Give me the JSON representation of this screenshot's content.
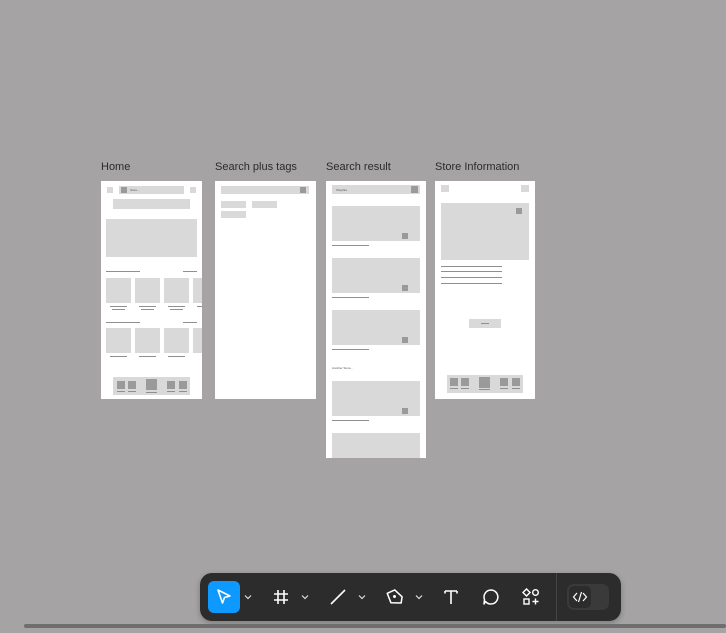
{
  "frames": [
    {
      "label": "Home"
    },
    {
      "label": "Search plus tags"
    },
    {
      "label": "Search result"
    },
    {
      "label": "Store Information"
    }
  ],
  "home": {
    "search_text": "Store..."
  },
  "search_result": {
    "search_text": "Shopfire",
    "section_text": "Another Store..."
  },
  "toolbar": {
    "tools": [
      {
        "icon": "move-cursor-icon",
        "active": true
      },
      {
        "icon": "frame-icon"
      },
      {
        "icon": "line-icon"
      },
      {
        "icon": "pen-icon"
      },
      {
        "icon": "text-icon"
      },
      {
        "icon": "comment-icon"
      },
      {
        "icon": "actions-icon"
      }
    ],
    "dev_mode_icon": "code-icon",
    "accent": "#0d99ff"
  }
}
